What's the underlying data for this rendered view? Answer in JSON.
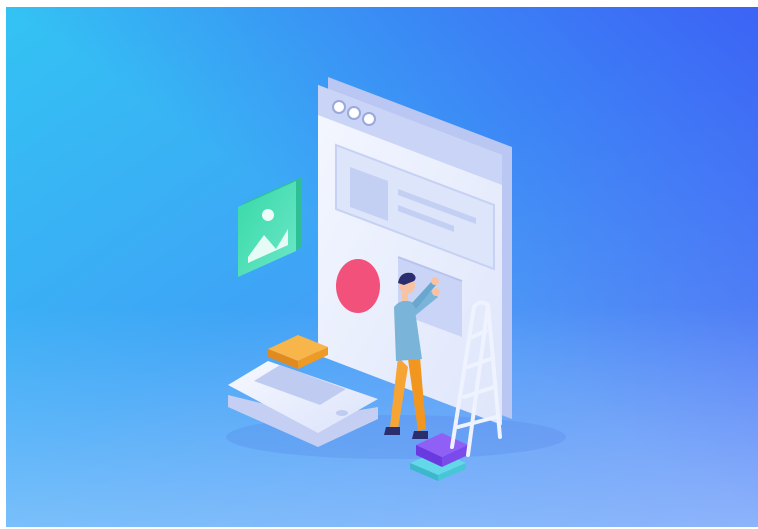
{
  "scene": {
    "colors": {
      "background_start": "#38c6f4",
      "background_end": "#3d63f6",
      "accent_red": "#f2517b",
      "accent_orange": "#f6a534",
      "accent_purple": "#7d4cf0",
      "accent_teal": "#3fd1b6",
      "accent_green": "#40d7a8"
    },
    "icons": [
      "browser-window-icon",
      "image-card-icon",
      "smartphone-icon",
      "ladder-icon",
      "person-figure"
    ]
  }
}
